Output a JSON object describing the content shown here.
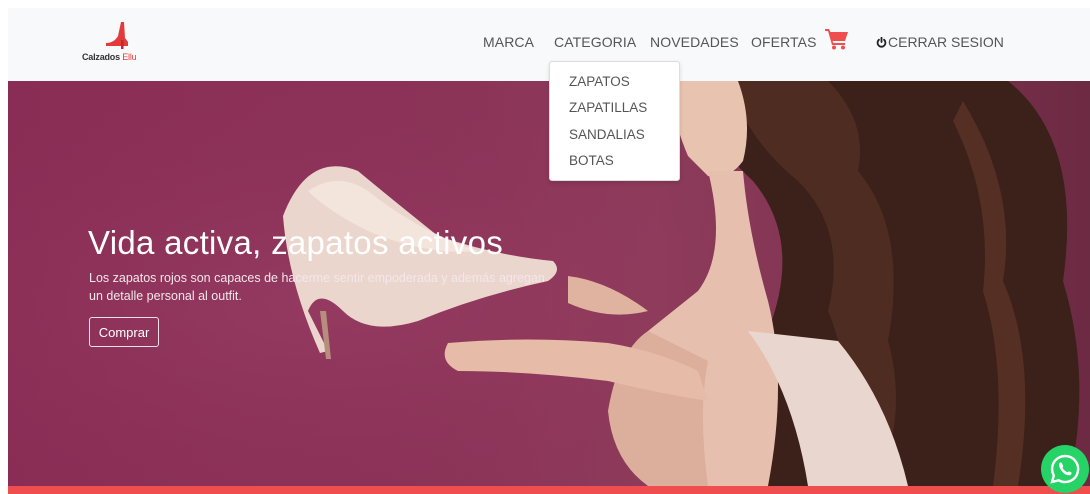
{
  "brand": {
    "name_main": "Calzados",
    "name_accent": "Ellu",
    "logo_icon": "high-heel-icon",
    "accent_color": "#e23b3b"
  },
  "nav": {
    "items": [
      "MARCA",
      "CATEGORIA",
      "NOVEDADES",
      "OFERTAS"
    ],
    "cart_icon": "shopping-cart-icon",
    "cart_color": "#f04e4e",
    "logout_icon": "power-icon",
    "logout_label": "CERRAR SESION"
  },
  "dropdown": {
    "items": [
      "ZAPATOS",
      "ZAPATILLAS",
      "SANDALIAS",
      "BOTAS"
    ]
  },
  "hero": {
    "title": "Vida activa, zapatos activos",
    "text": "Los zapatos rojos son capaces de hacerme sentir empoderada y además agregan un detalle personal al outfit.",
    "button_label": "Comprar",
    "background_color": "#8a2d56"
  },
  "footer_strip_color": "#f04e4e",
  "whatsapp": {
    "icon": "whatsapp-icon",
    "color": "#25d366"
  }
}
